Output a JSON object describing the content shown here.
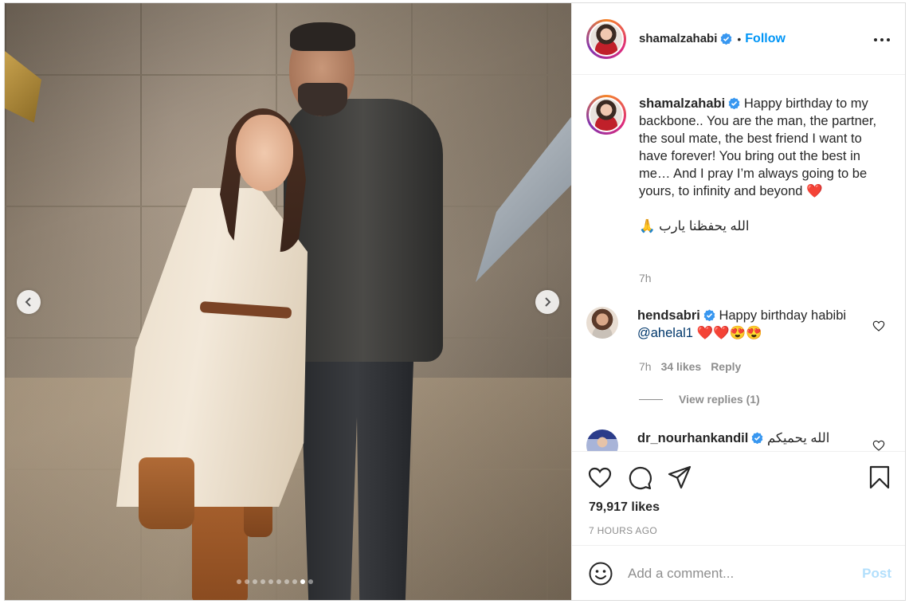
{
  "post": {
    "carousel": {
      "dot_count": 10,
      "active_index": 8
    },
    "author": {
      "username": "shamalzahabi",
      "verified": true,
      "follow_separator": "•",
      "follow_label": "Follow"
    },
    "caption": {
      "username": "shamalzahabi",
      "text": "Happy birthday to my backbone.. You are the man, the partner, the soul mate, the best friend I want to have forever! You bring out the best in me… And I pray I’m always going to be yours, to infinity and beyond ❤️",
      "arabic_line": "الله يحفظنا يارب 🙏",
      "time": "7h"
    },
    "comments": [
      {
        "username": "hendsabri",
        "text_prefix": "Happy birthday habibi",
        "mention": "@ahelal1",
        "text_suffix": "❤️❤️😍😍",
        "time": "7h",
        "likes": "34 likes",
        "reply_label": "Reply",
        "view_replies": "View replies (1)"
      },
      {
        "username": "dr_nourhankandil",
        "text": "الله يحميكم"
      }
    ],
    "likes_text": "79,917 likes",
    "time_ago": "7 HOURS AGO",
    "add_comment": {
      "placeholder": "Add a comment...",
      "post_label": "Post"
    },
    "icons": [
      "like-icon",
      "comment-icon",
      "share-icon",
      "save-icon",
      "emoji-icon",
      "more-options-icon",
      "verified-badge-icon",
      "chevron-left-icon",
      "chevron-right-icon"
    ],
    "colors": {
      "link_blue": "#0095f6",
      "post_disabled": "#b2dffc",
      "muted": "#8e8e8e",
      "text": "#262626",
      "verified": "#3897f0"
    }
  }
}
